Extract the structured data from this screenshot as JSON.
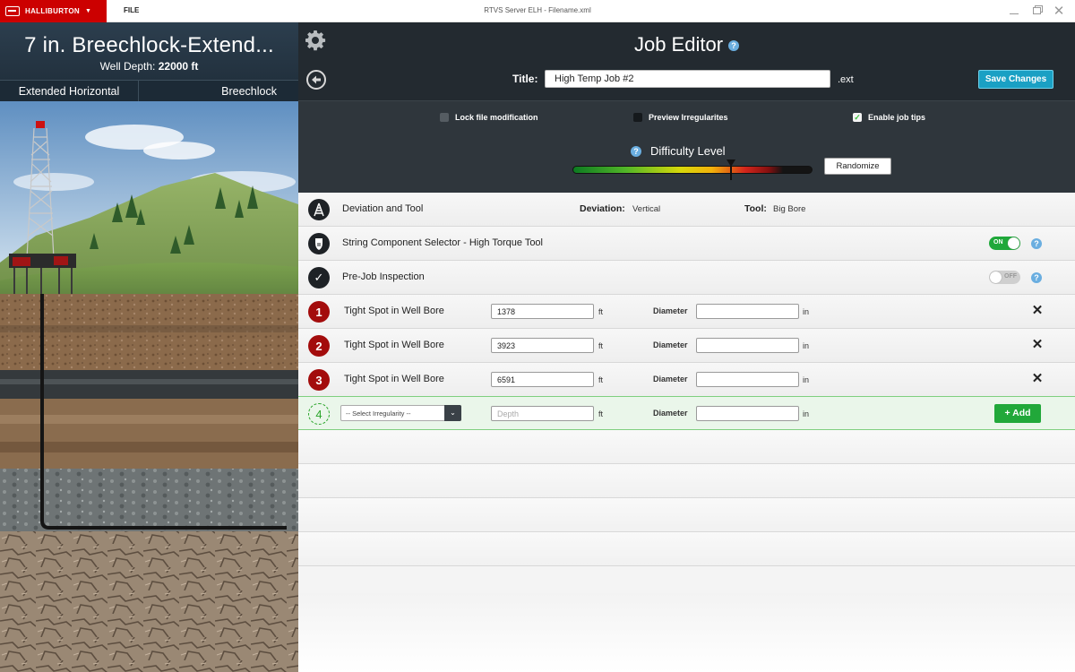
{
  "titlebar": {
    "brand": "HALLIBURTON",
    "brand_caret": "▼",
    "file_menu": "FILE",
    "window_title": "RTVS Server ELH - Filename.xml"
  },
  "left_panel": {
    "job_name": "7 in. Breechlock-Extend...",
    "well_depth_label": "Well Depth:",
    "well_depth_value": "22000 ft",
    "tabs": [
      "Extended Horizontal",
      "Breechlock"
    ]
  },
  "editor": {
    "heading": "Job Editor",
    "help_glyph": "?",
    "title_label": "Title:",
    "title_value": "High Temp Job #2",
    "extension": ".ext",
    "save_label": "Save Changes"
  },
  "options": {
    "lock_label": "Lock file modification",
    "lock_checked": false,
    "preview_label": "Preview Irregularites",
    "preview_checked": false,
    "tips_label": "Enable job tips",
    "tips_checked": true,
    "check_glyph": "✓",
    "difficulty_label": "Difficulty Level",
    "difficulty_level": 0.66,
    "randomize_label": "Randomize"
  },
  "rows": {
    "deviation": {
      "label": "Deviation and Tool",
      "deviation_label": "Deviation:",
      "deviation_value": "Vertical",
      "tool_label": "Tool:",
      "tool_value": "Big Bore"
    },
    "string_selector": {
      "label": "String Component Selector - High Torque Tool",
      "toggle": "ON"
    },
    "inspection": {
      "label": "Pre-Job Inspection",
      "check_glyph": "✓",
      "toggle": "OFF"
    },
    "irregularities": [
      {
        "number": "1",
        "label": "Tight Spot in Well Bore",
        "depth": "1378",
        "depth_unit": "ft",
        "diameter_label": "Diameter",
        "diameter": "",
        "diameter_unit": "in",
        "remove_glyph": "✕"
      },
      {
        "number": "2",
        "label": "Tight Spot in Well Bore",
        "depth": "3923",
        "depth_unit": "ft",
        "diameter_label": "Diameter",
        "diameter": "",
        "diameter_unit": "in",
        "remove_glyph": "✕"
      },
      {
        "number": "3",
        "label": "Tight Spot in Well Bore",
        "depth": "6591",
        "depth_unit": "ft",
        "diameter_label": "Diameter",
        "diameter": "",
        "diameter_unit": "in",
        "remove_glyph": "✕"
      }
    ],
    "new_item": {
      "number": "4",
      "select_placeholder": "-- Select Irregularity --",
      "select_caret": "⌄",
      "depth_placeholder": "Depth",
      "depth_unit": "ft",
      "diameter_label": "Diameter",
      "diameter_unit": "in",
      "add_label": "+ Add"
    }
  }
}
